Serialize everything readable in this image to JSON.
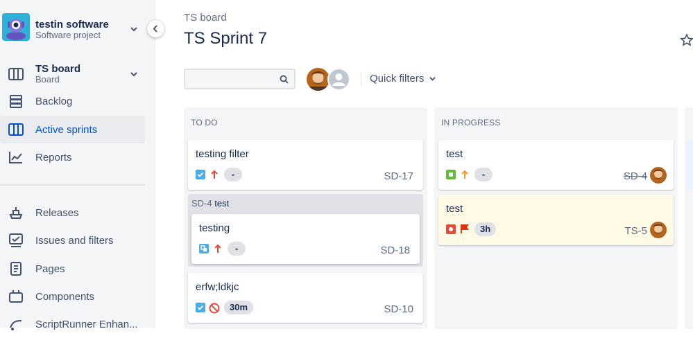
{
  "sidebar": {
    "project_name": "testin software",
    "project_type": "Software project",
    "board_name": "TS board",
    "board_sub": "Board",
    "items": [
      {
        "label": "Backlog",
        "icon": "backlog-icon"
      },
      {
        "label": "Active sprints",
        "icon": "active-sprints-icon",
        "active": true
      },
      {
        "label": "Reports",
        "icon": "reports-icon"
      },
      {
        "label": "Releases",
        "icon": "releases-icon"
      },
      {
        "label": "Issues and filters",
        "icon": "issues-icon"
      },
      {
        "label": "Pages",
        "icon": "pages-icon"
      },
      {
        "label": "Components",
        "icon": "components-icon"
      },
      {
        "label": "ScriptRunner Enhan...",
        "icon": "scriptrunner-icon"
      }
    ]
  },
  "header": {
    "breadcrumb": "TS board",
    "title": "TS Sprint 7",
    "quick_filters": "Quick filters"
  },
  "colors": {
    "accent": "#0052CC",
    "story": "#63BA3C",
    "bug": "#E5493A",
    "task": "#4BADE8",
    "priority_high": "#E5493A",
    "priority_medium": "#FF991F",
    "flagged_bg": "#FFFAE6"
  },
  "columns": [
    {
      "title": "TO DO",
      "cards": [
        {
          "summary": "testing filter",
          "key": "SD-17",
          "badge": "-",
          "type": "task-icon",
          "priority": "priority-high-icon"
        },
        {
          "summary": "testing",
          "key": "SD-18",
          "badge": "-",
          "type": "subtask-icon",
          "priority": "priority-high-icon",
          "parent_key": "SD-4",
          "parent_summary": "test"
        },
        {
          "summary": "erfw;ldkjc",
          "key": "SD-10",
          "badge": "30m",
          "type": "task-icon",
          "priority": "blocker-icon"
        }
      ]
    },
    {
      "title": "IN PROGRESS",
      "cards": [
        {
          "summary": "test",
          "key": "SD-4",
          "badge": "-",
          "type": "story-icon",
          "priority": "priority-medium-icon"
        },
        {
          "summary": "test",
          "key": "TS-5",
          "badge": "3h",
          "type": "bug-icon",
          "flag": "flag-icon"
        }
      ]
    }
  ]
}
